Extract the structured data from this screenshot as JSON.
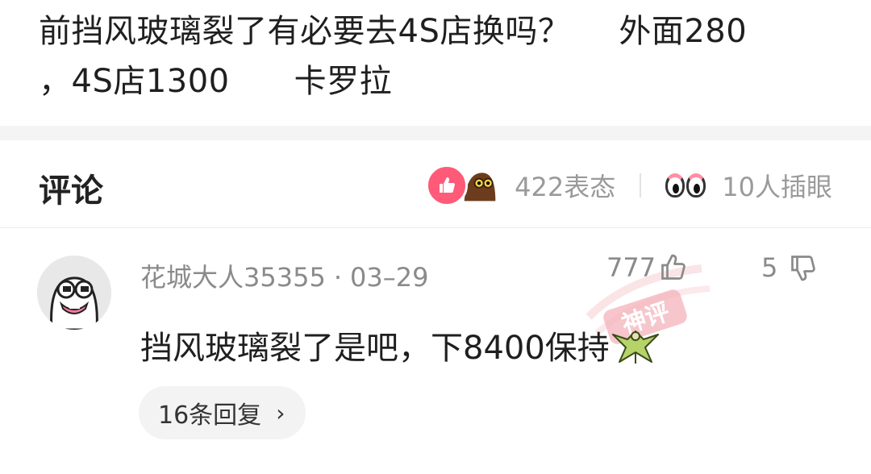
{
  "post": {
    "line1": "前挡风玻璃裂了有必要去4S店换吗？",
    "line1_extra": "外面280",
    "line2_a": "，4S店1300",
    "line2_b": "卡罗拉"
  },
  "comments_header": {
    "title": "评论",
    "reactions_count": "422表态",
    "watchers_count": "10人插眼"
  },
  "comment": {
    "username": "花城大人35355",
    "separator": "·",
    "date": "03–29",
    "likes": "777",
    "dislikes": "5",
    "body": "挡风玻璃裂了是吧，下8400保持",
    "reply_label": "16条回复",
    "reply_chevron": "›",
    "stamp_text": "神评"
  },
  "icons": {
    "like": "thumb-up-icon",
    "dislike": "thumb-down-icon",
    "reaction_like": "like-reaction-icon",
    "reaction_face": "peek-face-reaction-icon",
    "watch": "eyes-icon"
  },
  "colors": {
    "accent_pink": "#ff5a78",
    "muted_text": "#8a8a8a",
    "stamp_red": "#f2a3ac"
  }
}
